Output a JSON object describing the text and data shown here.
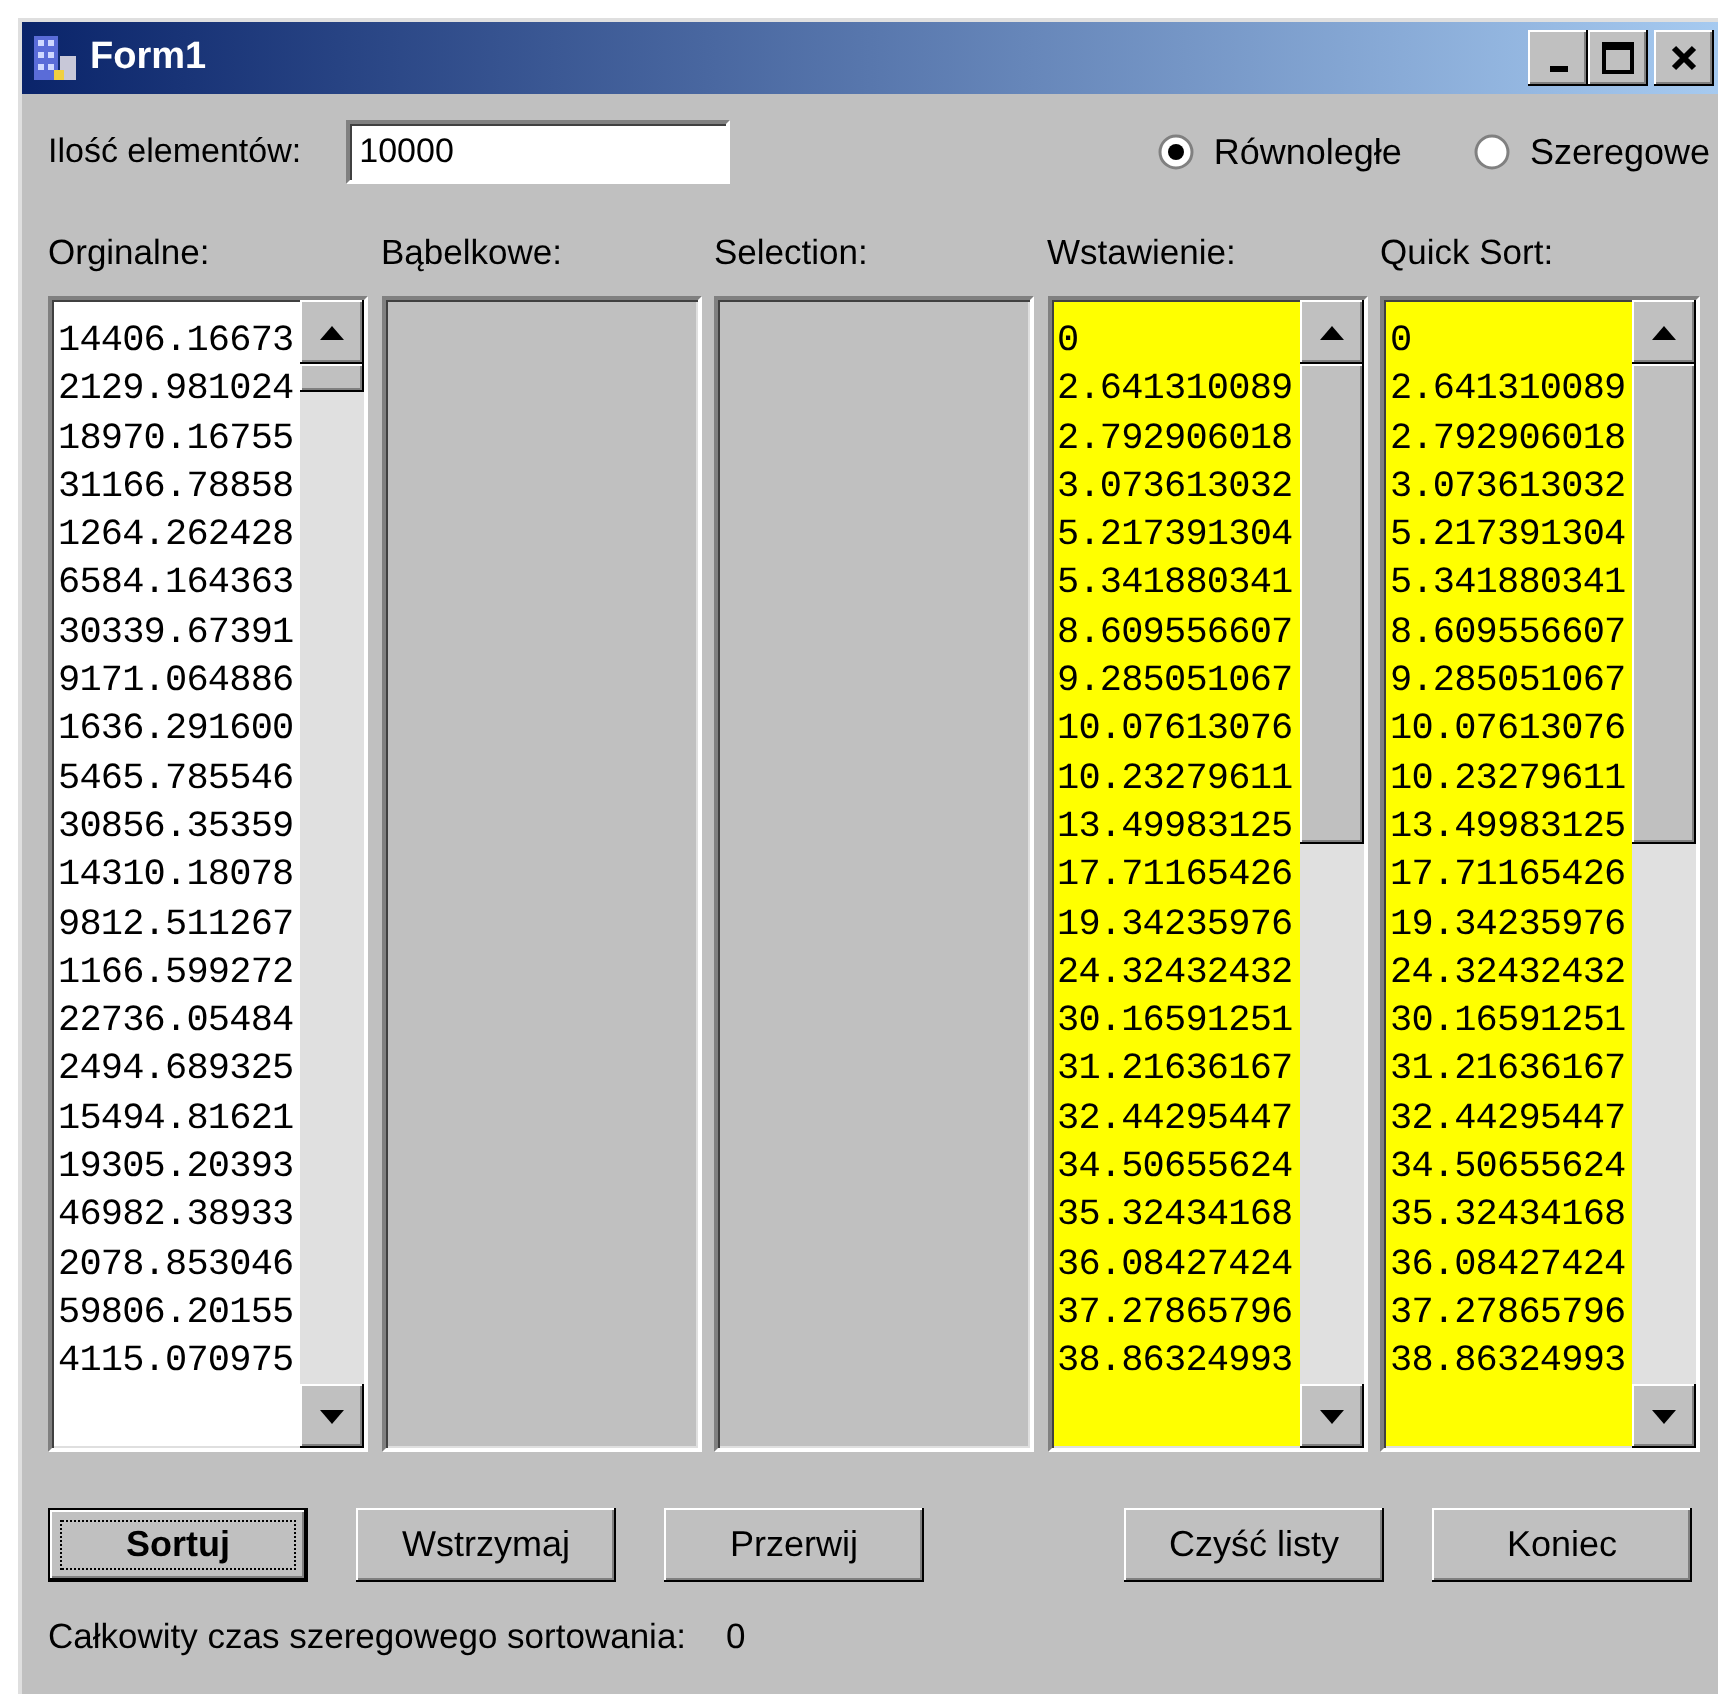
{
  "window": {
    "title": "Form1"
  },
  "count": {
    "label": "Ilość elementów:",
    "value": "10000"
  },
  "modes": [
    {
      "label": "Równoległe",
      "selected": true
    },
    {
      "label": "Szeregowe",
      "selected": false
    }
  ],
  "lists": [
    {
      "label": "Orginalne:",
      "color": "#ffffff",
      "items": [
        "14406.16673",
        "2129.981024",
        "18970.16755",
        "31166.78858",
        "1264.262428",
        "6584.164363",
        "30339.67391",
        "9171.064886",
        "1636.291600",
        "5465.785546",
        "30856.35359",
        "14310.18078",
        "9812.511267",
        "1166.599272",
        "22736.05484",
        "2494.689325",
        "15494.81621",
        "19305.20393",
        "46982.38933",
        "2078.853046",
        "59806.20155",
        "4115.070975"
      ]
    },
    {
      "label": "Bąbelkowe:",
      "color": "#c0c0c0"
    },
    {
      "label": "Selection:",
      "color": "#c0c0c0"
    },
    {
      "label": "Wstawienie:",
      "color": "#ffff00",
      "items": [
        "0",
        "2.641310089",
        "2.792906018",
        "3.073613032",
        "5.217391304",
        "5.341880341",
        "8.609556607",
        "9.285051067",
        "10.07613076",
        "10.23279611",
        "13.49983125",
        "17.71165426",
        "19.34235976",
        "24.32432432",
        "30.16591251",
        "31.21636167",
        "32.44295447",
        "34.50655624",
        "35.32434168",
        "36.08427424",
        "37.27865796",
        "38.86324993"
      ]
    },
    {
      "label": "Quick Sort:",
      "color": "#ffff00",
      "items": [
        "0",
        "2.641310089",
        "2.792906018",
        "3.073613032",
        "5.217391304",
        "5.341880341",
        "8.609556607",
        "9.285051067",
        "10.07613076",
        "10.23279611",
        "13.49983125",
        "17.71165426",
        "19.34235976",
        "24.32432432",
        "30.16591251",
        "31.21636167",
        "32.44295447",
        "34.50655624",
        "35.32434168",
        "36.08427424",
        "37.27865796",
        "38.86324993"
      ]
    }
  ],
  "buttons": [
    {
      "label": "Sortuj",
      "focused": true
    },
    {
      "label": "Wstrzymaj",
      "focused": false
    },
    {
      "label": "Przerwij",
      "focused": false
    },
    {
      "label": "Czyść listy",
      "focused": false
    },
    {
      "label": "Koniec",
      "focused": false
    }
  ],
  "status": {
    "label": "Całkowity czas szeregowego sortowania:",
    "value": "0"
  }
}
